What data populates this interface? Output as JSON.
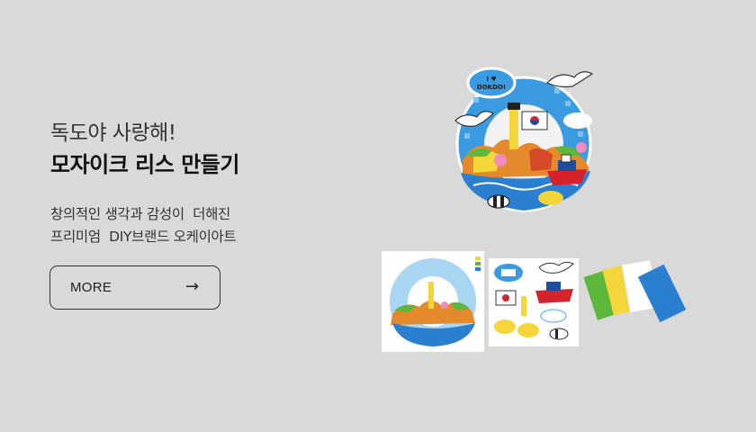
{
  "banner": {
    "subtitle": "독도야 사랑해!",
    "title": "모자이크 리스 만들기",
    "description_lines": [
      "창의적인 생각과 감성이  더해진",
      "프리미엄  DIY브랜드 오케이아트"
    ],
    "more_button": {
      "label": "MORE",
      "arrow": "→"
    }
  },
  "product_images": {
    "wreath_badge_text": "I ♥ DOKDO!",
    "colors": {
      "background": "#d9d9d9",
      "sky_blue": "#3a9be0",
      "sea_blue": "#2a7fd0",
      "rock_orange": "#e58a2c",
      "grass_green": "#5cb83a",
      "yellow": "#f4d63a"
    },
    "thumbnails": [
      {
        "name": "base-board"
      },
      {
        "name": "sticker-sheet"
      },
      {
        "name": "mosaic-paper-pack"
      }
    ]
  }
}
